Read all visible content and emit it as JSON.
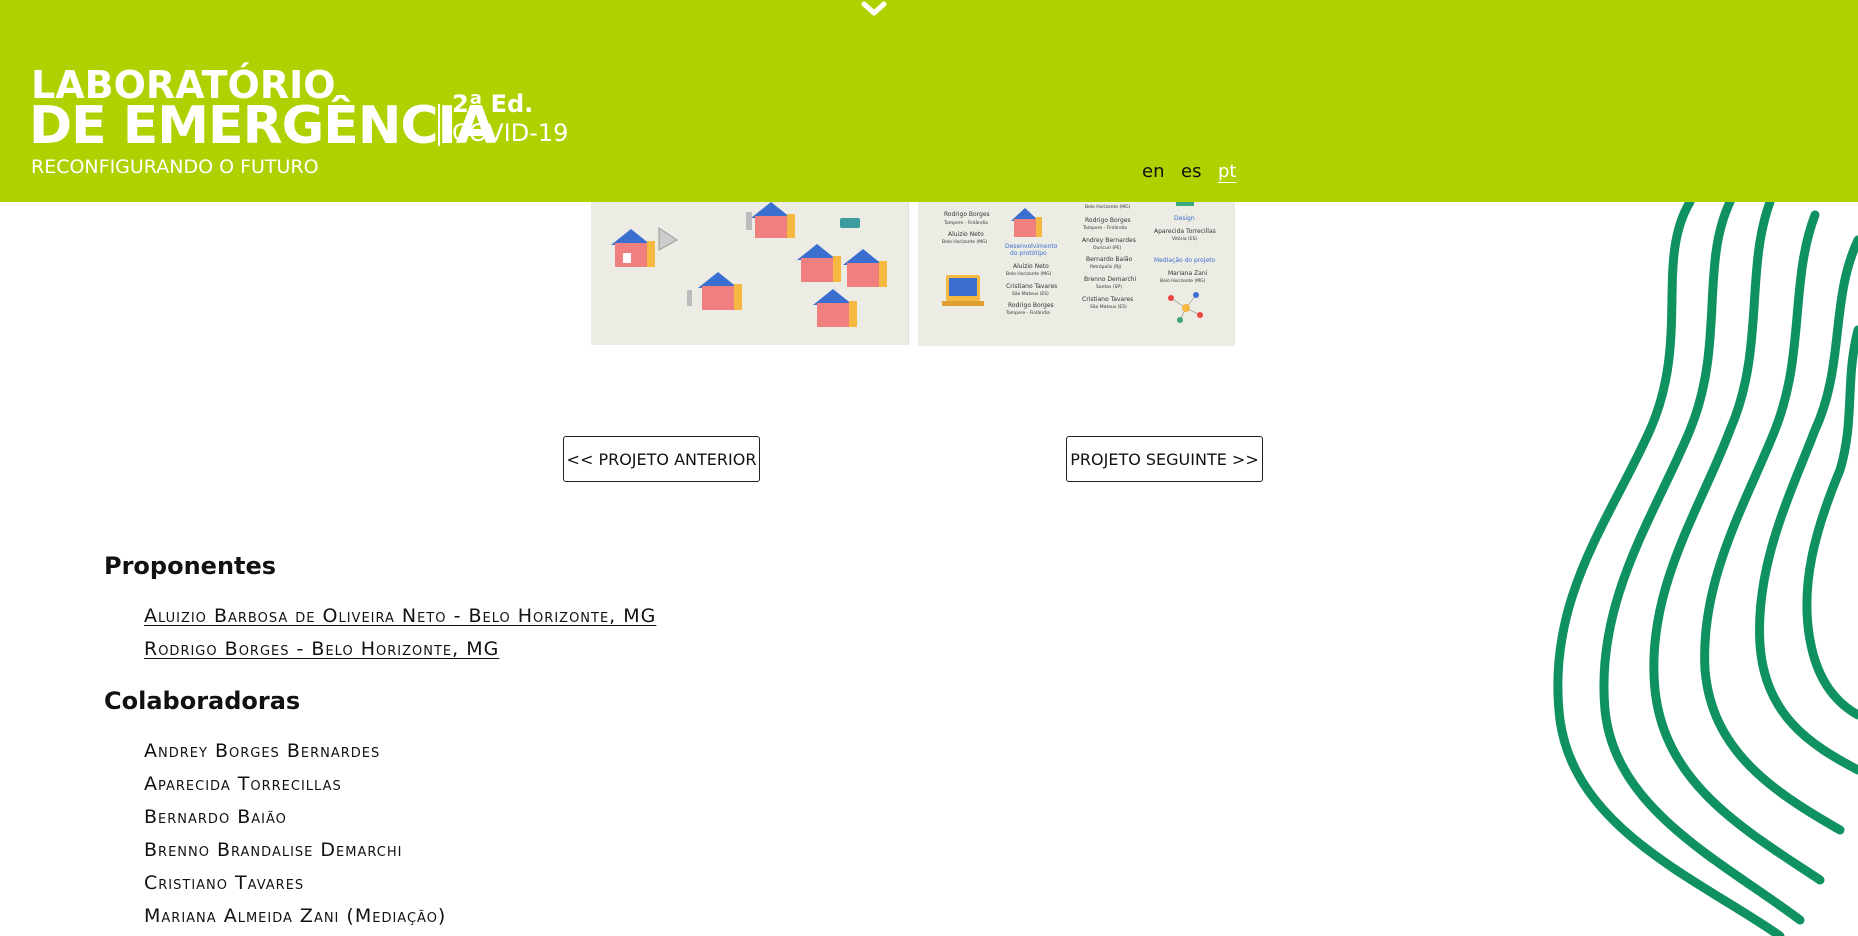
{
  "header": {
    "logo_line1": "LABORATÓRIO",
    "logo_line2": "DE EMERGÊNCIA",
    "edition": "2ª Ed.",
    "edition_sub": "COVID-19",
    "tagline": "RECONFIGURANDO O FUTURO",
    "languages": [
      {
        "code": "en",
        "active": false
      },
      {
        "code": "es",
        "active": false
      },
      {
        "code": "pt",
        "active": true
      }
    ],
    "accent_color": "#afd100"
  },
  "gallery": {
    "right_image_text": {
      "col1": [
        "Rodrigo Borges",
        "Tampere - Finlândia",
        "Aluizio Neto",
        "Belo Horizonte (MG)"
      ],
      "col2": [
        "Desenvolvimento",
        "do protótipo",
        "Aluizio Neto",
        "Belo Horizonte (MG)",
        "Cristiano Tavares",
        "São Mateus (ES)",
        "Rodrigo Borges",
        "Tampere - Finlândia"
      ],
      "col3": [
        "Belo Horizonte (MG)",
        "Rodrigo Borges",
        "Tampere - Finlândia",
        "Andrey Bernardes",
        "Ouricuri (PE)",
        "Bernardo Baião",
        "Petrópolis (RJ)",
        "Brenno Demarchi",
        "Santos (SP)",
        "Cristiano Tavares",
        "São Mateus (ES)"
      ],
      "col4": [
        "Design",
        "Aparecida Torrecillas",
        "Vitória (ES)",
        "Mediação do projeto",
        "Mariana Zani",
        "Belo Horizonte (MG)"
      ]
    }
  },
  "navigation": {
    "prev_label": "<< PROJETO ANTERIOR",
    "next_label": "PROJETO SEGUINTE >>"
  },
  "credits": {
    "proponents_title": "Proponentes",
    "proponents": [
      "Aluizio Barbosa de Oliveira Neto - Belo Horizonte, MG",
      "Rodrigo Borges - Belo Horizonte, MG"
    ],
    "collaborators_title": "Colaboradoras",
    "collaborators": [
      "Andrey Borges Bernardes",
      "Aparecida Torrecillas",
      "Bernardo Baião",
      "Brenno Brandalise Demarchi",
      "Cristiano Tavares",
      "Mariana Almeida Zani (Mediação)"
    ]
  }
}
